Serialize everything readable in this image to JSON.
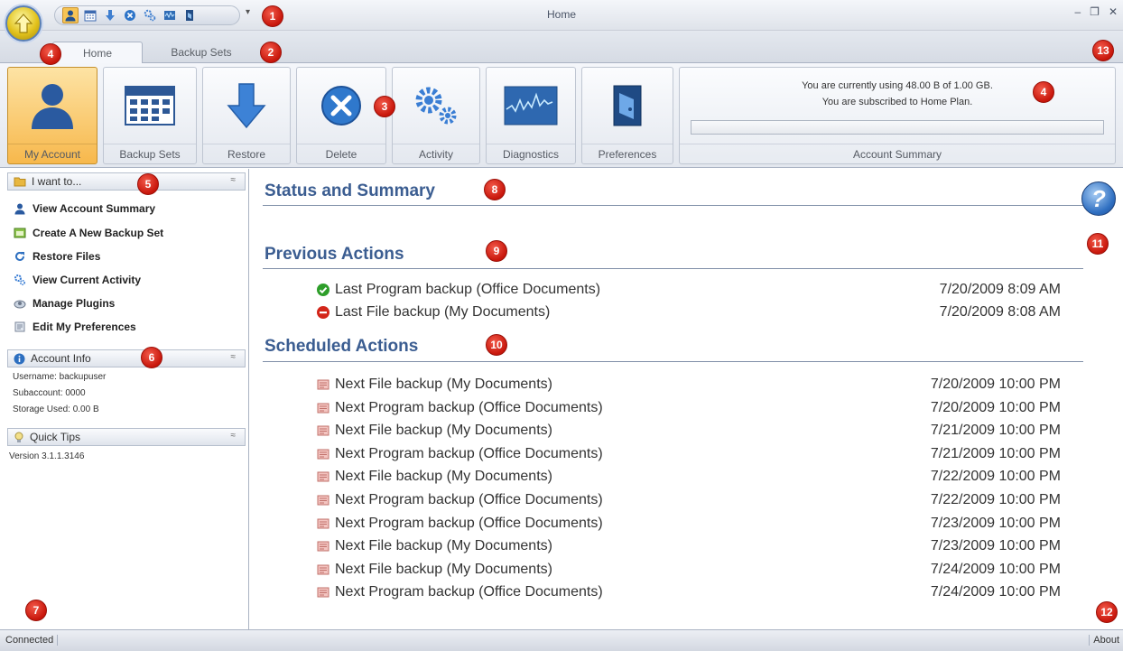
{
  "window": {
    "title": "Home",
    "controls": [
      "–",
      "❐",
      "✕"
    ],
    "qat_more": "▾"
  },
  "tabs": [
    {
      "label": "Home",
      "active": true
    },
    {
      "label": "Backup Sets",
      "active": false
    }
  ],
  "ribbon": {
    "buttons": [
      {
        "label": "My Account",
        "icon": "user-icon",
        "active": true
      },
      {
        "label": "Backup Sets",
        "icon": "calendar-icon"
      },
      {
        "label": "Restore",
        "icon": "arrow-down-icon"
      },
      {
        "label": "Delete",
        "icon": "delete-x-icon"
      },
      {
        "label": "Activity",
        "icon": "gears-icon"
      },
      {
        "label": "Diagnostics",
        "icon": "waveform-icon"
      },
      {
        "label": "Preferences",
        "icon": "preferences-icon"
      }
    ],
    "summary": {
      "line1": "You are currently using 48.00 B of 1.00 GB.",
      "line2": "You are subscribed to Home Plan.",
      "usage_fraction": 0.0,
      "label": "Account Summary"
    }
  },
  "sidebar": {
    "i_want_to": {
      "title": "I want to...",
      "collapse": "≈",
      "items": [
        {
          "label": "View Account Summary",
          "icon": "user-icon"
        },
        {
          "label": "Create A New Backup Set",
          "icon": "backup-set-icon"
        },
        {
          "label": "Restore Files",
          "icon": "restore-icon"
        },
        {
          "label": "View Current Activity",
          "icon": "gears-icon"
        },
        {
          "label": "Manage Plugins",
          "icon": "plugin-icon"
        },
        {
          "label": "Edit My Preferences",
          "icon": "preferences-icon"
        }
      ]
    },
    "account_info": {
      "title": "Account Info",
      "collapse": "≈",
      "lines": [
        "Username: backupuser",
        "Subaccount: 0000",
        "Storage Used: 0.00 B"
      ]
    },
    "quick_tips": {
      "title": "Quick Tips",
      "collapse": "≈"
    },
    "version": "Version 3.1.1.3146"
  },
  "main": {
    "status_heading": "Status and Summary",
    "previous_heading": "Previous Actions",
    "previous": [
      {
        "label": "Last Program backup (Office Documents)",
        "time": "7/20/2009 8:09 AM",
        "status": "success"
      },
      {
        "label": "Last File backup (My Documents)",
        "time": "7/20/2009 8:08 AM",
        "status": "error"
      }
    ],
    "scheduled_heading": "Scheduled Actions",
    "scheduled": [
      {
        "label": "Next File backup (My Documents)",
        "time": "7/20/2009 10:00 PM"
      },
      {
        "label": "Next Program backup (Office Documents)",
        "time": "7/20/2009 10:00 PM"
      },
      {
        "label": "Next File backup (My Documents)",
        "time": "7/21/2009 10:00 PM"
      },
      {
        "label": "Next Program backup (Office Documents)",
        "time": "7/21/2009 10:00 PM"
      },
      {
        "label": "Next File backup (My Documents)",
        "time": "7/22/2009 10:00 PM"
      },
      {
        "label": "Next Program backup (Office Documents)",
        "time": "7/22/2009 10:00 PM"
      },
      {
        "label": "Next Program backup (Office Documents)",
        "time": "7/23/2009 10:00 PM"
      },
      {
        "label": "Next File backup (My Documents)",
        "time": "7/23/2009 10:00 PM"
      },
      {
        "label": "Next File backup (My Documents)",
        "time": "7/24/2009 10:00 PM"
      },
      {
        "label": "Next Program backup (Office Documents)",
        "time": "7/24/2009 10:00 PM"
      }
    ],
    "help": "?"
  },
  "statusbar": {
    "status": "Connected",
    "about": "About"
  },
  "markers": [
    "1",
    "2",
    "3",
    "4",
    "4",
    "5",
    "6",
    "7",
    "8",
    "9",
    "10",
    "11",
    "12",
    "13"
  ],
  "colors": {
    "heading": "#3b5d91",
    "marker": "#c8160b",
    "active_ribbon": "#f7b84c",
    "success": "#2e9e2a",
    "error": "#d3261a"
  }
}
